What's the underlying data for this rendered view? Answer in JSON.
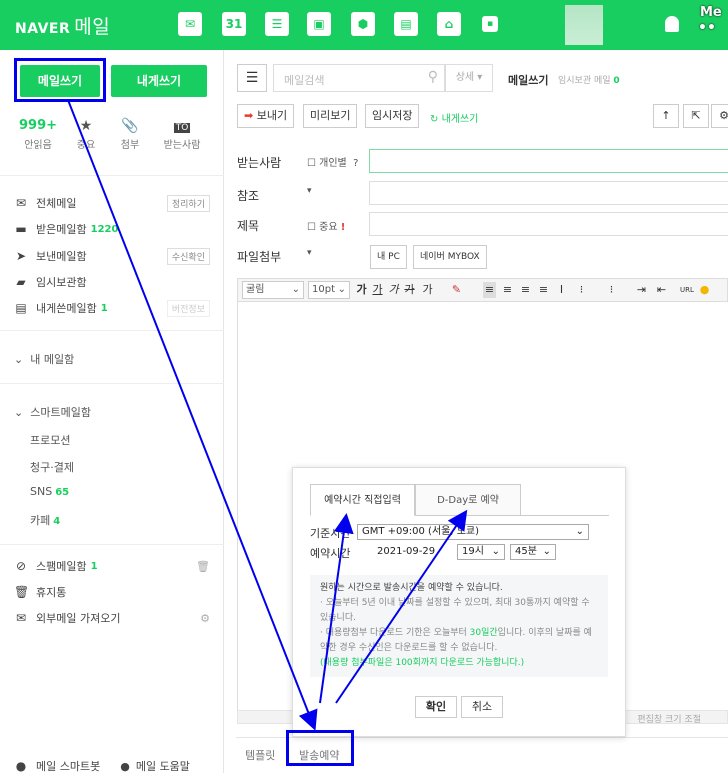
{
  "app": {
    "logo_text": "NAVER",
    "logo_sub": "메일",
    "top_right_line1": "Me",
    "top_right_line2": "••",
    "top_icons": [
      "mail-icon",
      "calendar-icon",
      "list-icon",
      "contacts-icon",
      "hexagon-icon",
      "memo-icon",
      "house-icon",
      "app-icon"
    ]
  },
  "sidebar": {
    "compose_label": "메일쓰기",
    "self_compose_label": "내게쓰기",
    "stats": [
      {
        "num": "999+",
        "label": "안읽음"
      },
      {
        "num": "",
        "label": "중요"
      },
      {
        "num": "",
        "label": "첨부"
      },
      {
        "num": "TO",
        "label": "받는사람"
      }
    ],
    "folders": [
      {
        "label": "전체메일",
        "count": "",
        "button": "정리하기"
      },
      {
        "label": "받은메일함",
        "count": "1220",
        "button": ""
      },
      {
        "label": "보낸메일함",
        "count": "",
        "button": "수신확인"
      },
      {
        "label": "임시보관함",
        "count": "",
        "button": ""
      },
      {
        "label": "내게쓴메일함",
        "count": "1",
        "button": "버전정보"
      }
    ],
    "my_mailbox": "내 메일함",
    "smart_title": "스마트메일함",
    "smart_items": [
      {
        "label": "프로모션",
        "count": ""
      },
      {
        "label": "청구·결제",
        "count": ""
      },
      {
        "label": "SNS",
        "count": "65"
      },
      {
        "label": "카페",
        "count": "4"
      }
    ],
    "spam": {
      "label": "스팸메일함",
      "count": "1"
    },
    "trash": "휴지통",
    "external": "외부메일 가져오기",
    "footer_left": "메일 스마트봇",
    "footer_right": "메일 도움말"
  },
  "main": {
    "search_placeholder": "메일검색",
    "search_detail": "상세",
    "compose_title": "메일쓰기",
    "draft_note": "임시보관 메일",
    "draft_count": "0",
    "send": "보내기",
    "preview": "미리보기",
    "save_draft": "임시저장",
    "self_write": "내게쓰기",
    "to_label": "받는사람",
    "individual": "개인별",
    "help_q": "?",
    "cc_label": "참조",
    "subject_label": "제목",
    "important": "중요",
    "important_mark": "!",
    "attach_label": "파일첨부",
    "my_pc": "내 PC",
    "mybox": "네이버 MYBOX",
    "font_select": "굴림",
    "size_select": "10pt",
    "resize_note": "편집창 크기 조절",
    "template": "템플릿",
    "schedule_send": "발송예약"
  },
  "dialog": {
    "tab_direct": "예약시간 직접입력",
    "tab_dday": "D-Day로 예약",
    "base_time_label": "기준시간",
    "timezone": "GMT +09:00 (서울, 도쿄)",
    "reserve_time_label": "예약시간",
    "date": "2021-09-29",
    "hour": "19시",
    "minute": "45분",
    "notice_first": "원하는 시간으로 발송시간을 예약할 수 있습니다.",
    "notice_line2": "· 오늘부터 5년 이내 날짜를 설정할 수 있으며, 최대 30통까지 예약할 수 있습니다.",
    "notice_line3a": "· 대용량첨부 다운로드 기한은 오늘부터 ",
    "notice_line3b": "30일간",
    "notice_line3c": "입니다. 이후의 날짜를 예약한 경우 수신인은 다운로드를 할 수 없습니다.",
    "notice_line4": "(대용량 첨부파일은 100회까지 다운로드 가능합니다.)",
    "confirm": "확인",
    "cancel": "취소"
  },
  "colors": {
    "brand": "#19ce60",
    "annotation": "#0000ee"
  }
}
